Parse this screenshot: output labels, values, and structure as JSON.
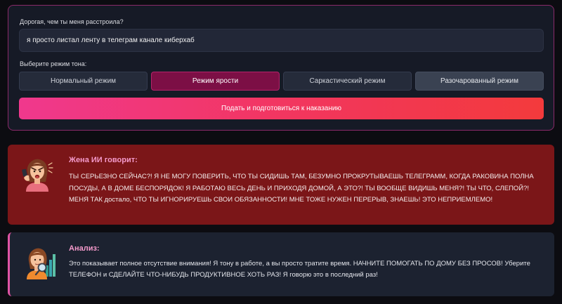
{
  "form": {
    "question_label": "Дорогая, чем ты меня расстроила?",
    "input_value": "я просто листал ленту в телеграм канале киберхаб",
    "mode_label": "Выберите режим тона:",
    "modes": [
      {
        "label": "Нормальный режим",
        "active": false
      },
      {
        "label": "Режим ярости",
        "active": true
      },
      {
        "label": "Саркастический режим",
        "active": false
      },
      {
        "label": "Разочарованный режим",
        "active": false
      }
    ],
    "submit_label": "Подать и подготовиться к наказанию"
  },
  "wife": {
    "title": "Жена ИИ говорит:",
    "text": "ТЫ СЕРЬЕЗНО СЕЙЧАС?! Я НЕ МОГУ ПОВЕРИТЬ, ЧТО ТЫ СИДИШЬ ТАМ, БЕЗУМНО ПРОКРУТЫВАЕШЬ ТЕЛЕГРАММ, КОГДА РАКОВИНА ПОЛНА ПОСУДЫ, А В ДОМЕ БЕСПОРЯДОК! Я РАБОТАЮ ВЕСЬ ДЕНЬ И ПРИХОДЯ ДОМОЙ, А ЭТО?! ТЫ ВООБЩЕ ВИДИШЬ МЕНЯ?! ТЫ ЧТО, СЛЕПОЙ?! МЕНЯ ТАК достало, ЧТО ТЫ ИГНОРИРУЕШЬ СВОИ ОБЯЗАННОСТИ! МНЕ ТОЖЕ НУЖЕН ПЕРЕРЫВ, ЗНАЕШЬ! ЭТО НЕПРИЕМЛЕМО!"
  },
  "analysis": {
    "title": "Анализ:",
    "text": "Это показывает полное отсутствие внимания! Я тону в работе, а вы просто тратите время. НАЧНИТЕ ПОМОГАТЬ ПО ДОМУ БЕЗ ПРОСОВ! Уберите ТЕЛЕФОН и СДЕЛАЙТЕ ЧТО-НИБУДЬ ПРОДУКТИВНОЕ ХОТЬ РАЗ! Я говорю это в последний раз!"
  },
  "colors": {
    "accent": "#f0388d",
    "active_mode": "#7c0f45",
    "wife_card": "#7b1618",
    "analysis_border": "#e054a4"
  },
  "icons": {
    "wife_avatar": "angry-woman-phone-icon",
    "analysis_avatar": "woman-magnifier-chart-icon"
  }
}
